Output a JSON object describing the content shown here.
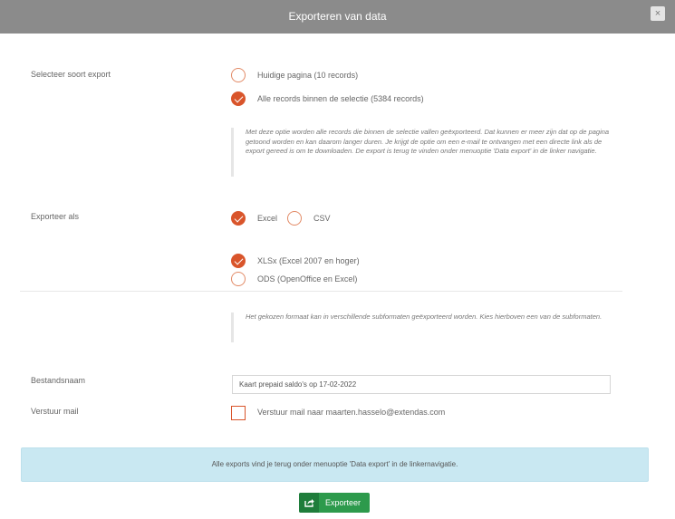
{
  "header": {
    "title": "Exporteren van data",
    "close_glyph": "×"
  },
  "export_type": {
    "label": "Selecteer soort export",
    "options": [
      {
        "label": "Huidige pagina (10 records)",
        "selected": false
      },
      {
        "label": "Alle records binnen de selectie (5384 records)",
        "selected": true
      }
    ],
    "info": "Met deze optie worden alle records die binnen de selectie vallen geëxporteerd. Dat kunnen er meer zijn dat op de pagina getoond worden en kan daarom langer duren. Je krijgt de optie om een e-mail te ontvangen met een directe link als de export gereed is om te downloaden. De export is terug te vinden onder menuoptie 'Data export' in de linker navigatie."
  },
  "export_as": {
    "label": "Exporteer als",
    "formats": [
      {
        "label": "Excel",
        "selected": true
      },
      {
        "label": "CSV",
        "selected": false
      }
    ],
    "subformats": [
      {
        "label": "XLSx (Excel 2007 en hoger)",
        "selected": true
      },
      {
        "label": "ODS (OpenOffice en Excel)",
        "selected": false
      }
    ],
    "info": "Het gekozen formaat kan in verschillende subformaten geëxporteerd worden. Kies hierboven een van de subformaten."
  },
  "filename": {
    "label": "Bestandsnaam",
    "value": "Kaart prepaid saldo's op 17-02-2022"
  },
  "send_mail": {
    "label": "Verstuur mail",
    "checkbox_label": "Verstuur mail naar maarten.hasselo@extendas.com",
    "checked": false
  },
  "banner": {
    "text": "Alle exports vind je terug onder menuoptie 'Data export' in de linkernavigatie."
  },
  "export_button": {
    "label": "Exporteer",
    "icon": "share-icon"
  },
  "colors": {
    "accent": "#d9552b",
    "button": "#2d9a4c",
    "header": "#8b8b8b",
    "banner": "#c9e8f2"
  }
}
